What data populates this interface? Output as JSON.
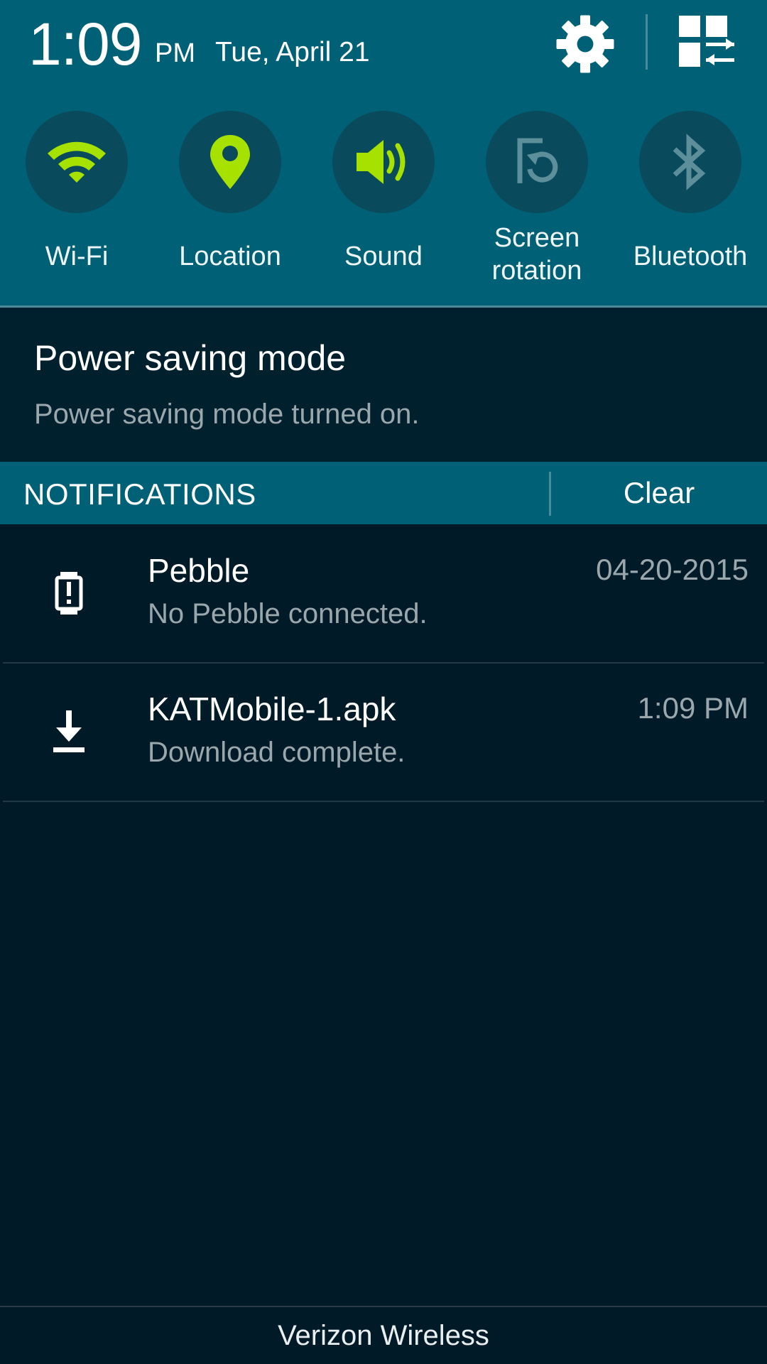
{
  "status": {
    "time": "1:09",
    "ampm": "PM",
    "date": "Tue, April 21"
  },
  "header_icons": {
    "settings": "gear-icon",
    "multi_window": "multi-window-icon"
  },
  "quick_settings": [
    {
      "label": "Wi-Fi",
      "icon": "wifi-icon",
      "active": true
    },
    {
      "label": "Location",
      "icon": "location-pin-icon",
      "active": true
    },
    {
      "label": "Sound",
      "icon": "speaker-icon",
      "active": true
    },
    {
      "label": "Screen rotation",
      "label_line1": "Screen",
      "label_line2": "rotation",
      "icon": "screen-rotation-icon",
      "active": false
    },
    {
      "label": "Bluetooth",
      "icon": "bluetooth-icon",
      "active": false
    }
  ],
  "power_saving": {
    "title": "Power saving mode",
    "subtitle": "Power saving mode turned on."
  },
  "notifications_bar": {
    "title": "NOTIFICATIONS",
    "clear_label": "Clear"
  },
  "notifications": [
    {
      "title": "Pebble",
      "subtitle": "No Pebble connected.",
      "time": "04-20-2015",
      "icon": "pebble-watch-icon"
    },
    {
      "title": "KATMobile-1.apk",
      "subtitle": "Download complete.",
      "time": "1:09 PM",
      "icon": "download-icon"
    }
  ],
  "footer": {
    "carrier": "Verizon Wireless"
  },
  "colors": {
    "header": "#006075",
    "active_icon": "#a6e100",
    "inactive_icon": "#5d8f9b",
    "background": "#001b27"
  }
}
